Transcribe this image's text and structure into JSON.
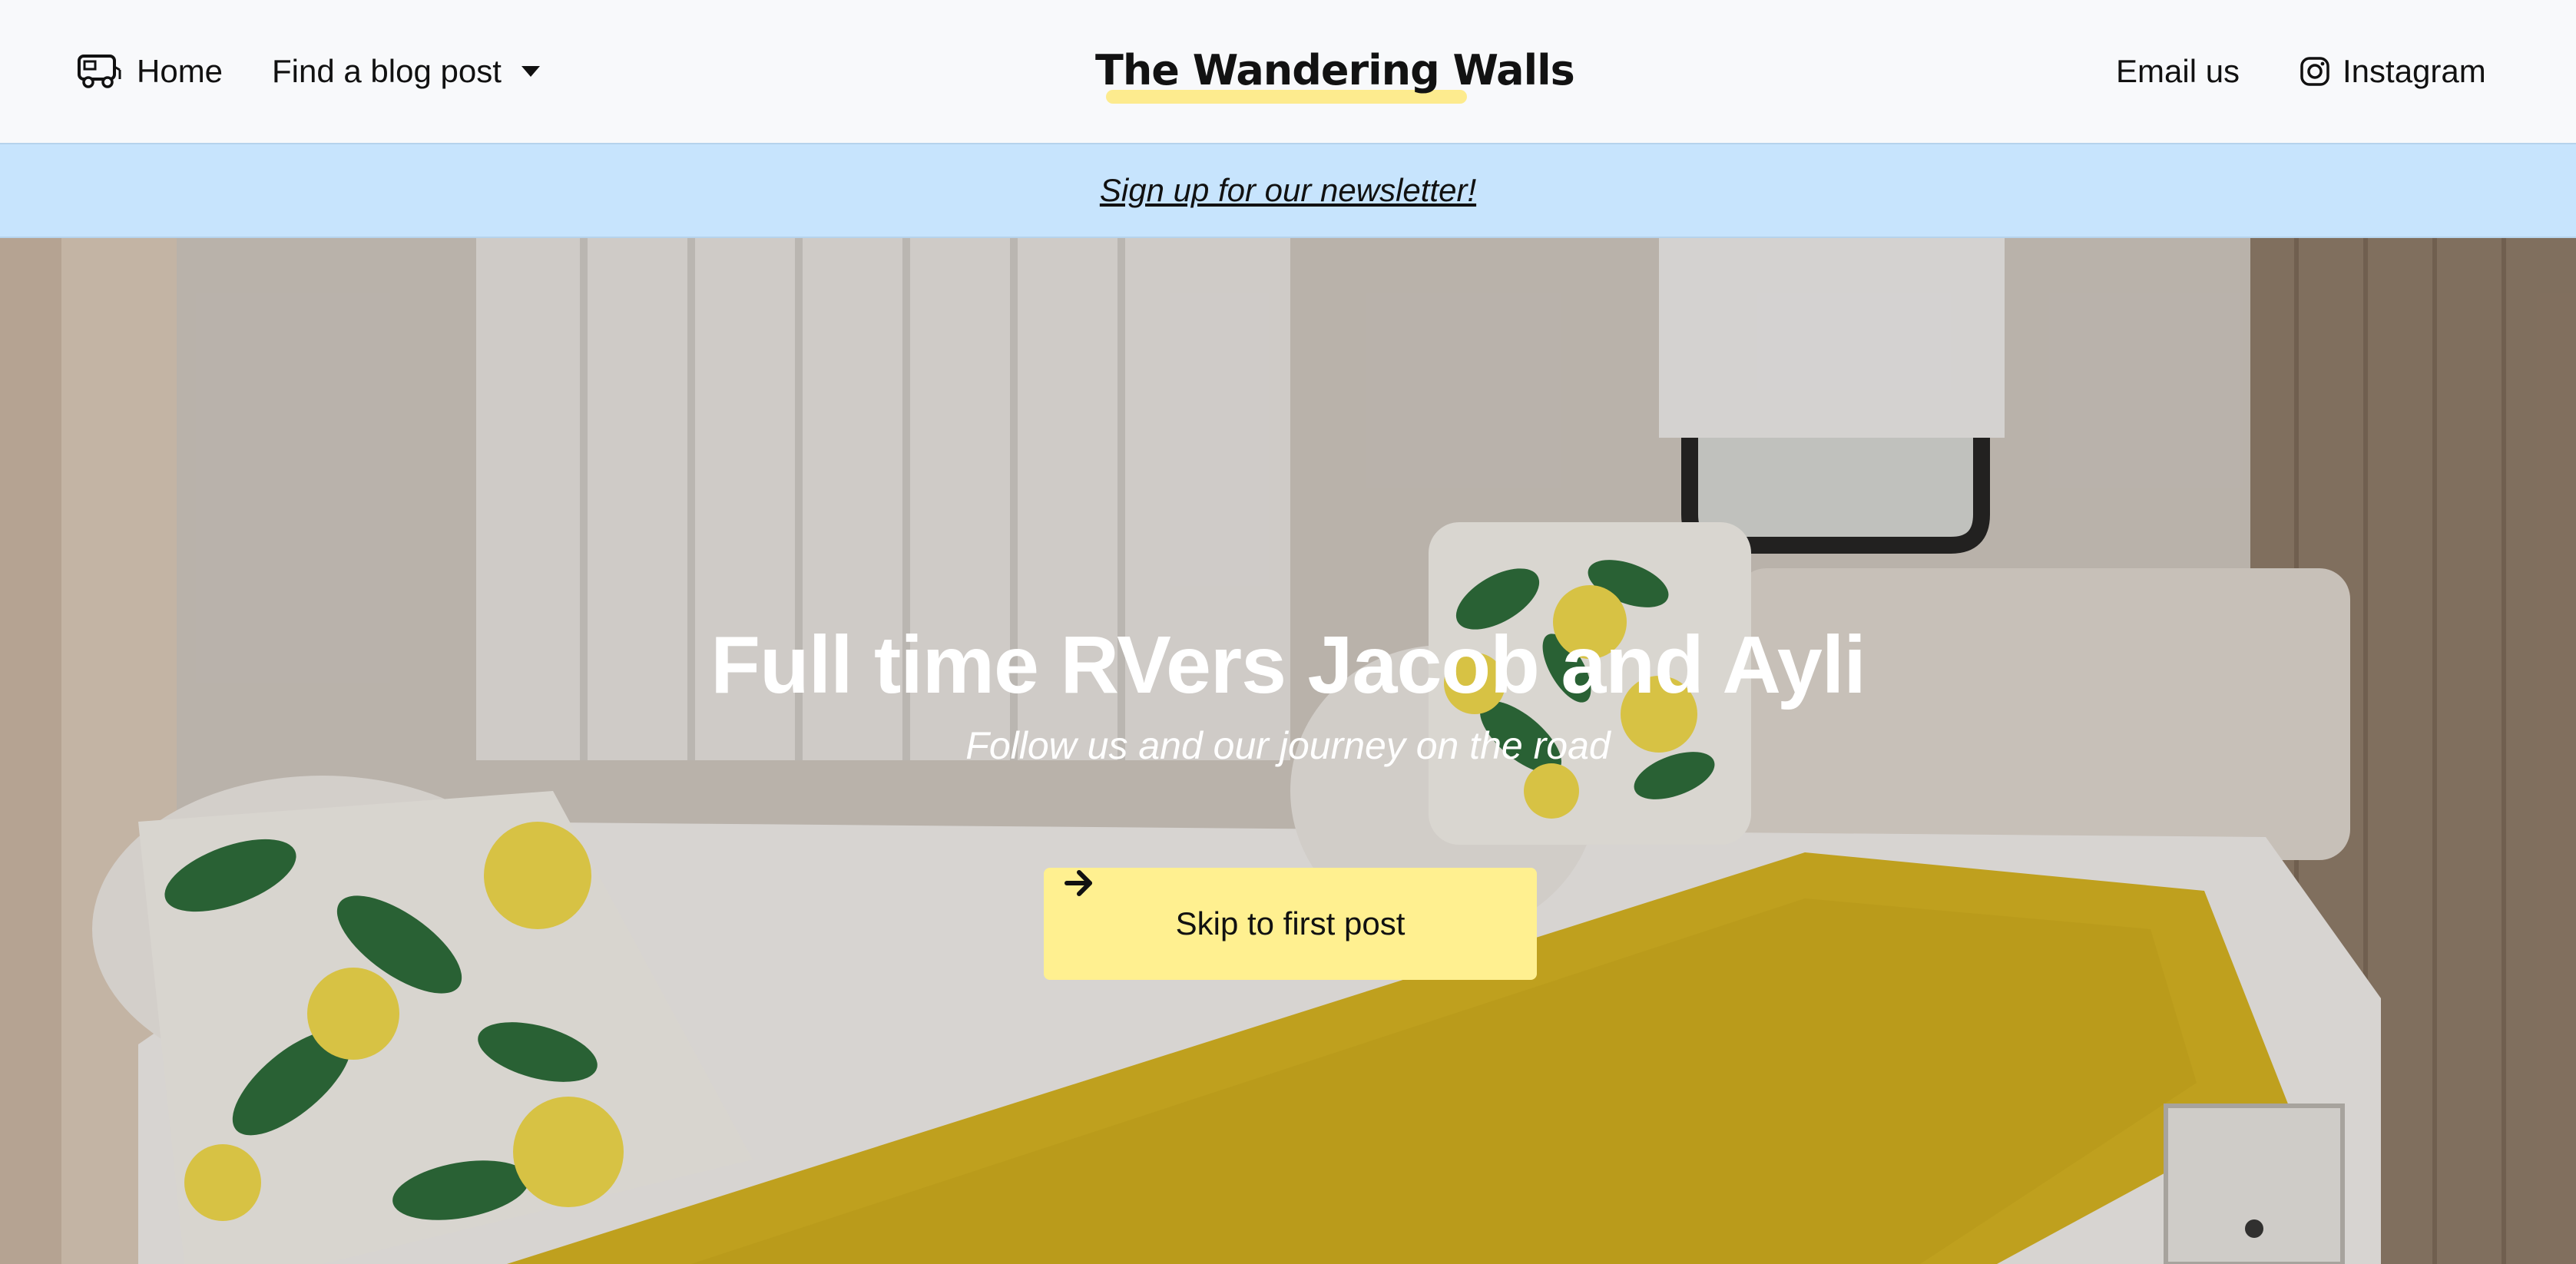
{
  "navbar": {
    "home_label": "Home",
    "find_label": "Find a blog post",
    "brand": "The Wandering Walls",
    "email_label": "Email us",
    "instagram_label": "Instagram",
    "icons": {
      "home": "rv-camper-icon",
      "find": "caret-down-icon",
      "instagram": "instagram-icon"
    }
  },
  "banner": {
    "text": "Sign up for our newsletter!"
  },
  "hero": {
    "title": "Full time RVers Jacob and Ayli",
    "subtitle": "Follow us and our journey on the road",
    "cta_label": "Skip to first post",
    "cta_icon": "arrow-right-icon"
  },
  "colors": {
    "nav_bg": "#f8f9fb",
    "banner_bg": "#c7e4fd",
    "brand_underline": "#fdeb8e",
    "cta_bg": "#fff090",
    "blanket": "#d4b21f",
    "leaf": "#2a6a38",
    "lemon": "#f0d94a"
  }
}
